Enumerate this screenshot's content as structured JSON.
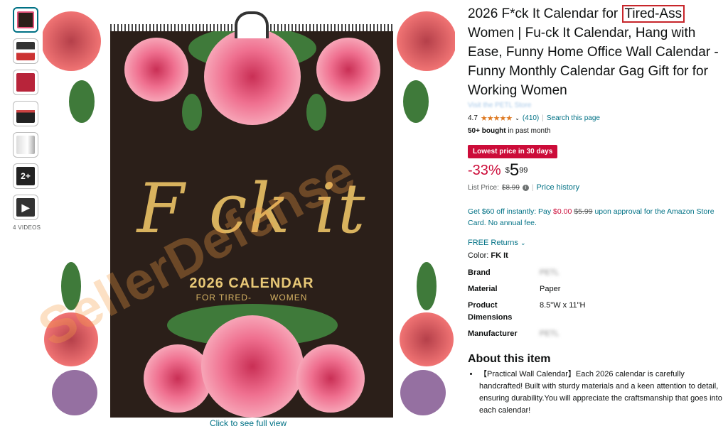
{
  "thumbnails": {
    "items": [
      {
        "name": "thumb-1",
        "selected": true,
        "label": ""
      },
      {
        "name": "thumb-2",
        "label": ""
      },
      {
        "name": "thumb-3",
        "label": ""
      },
      {
        "name": "thumb-4",
        "label": ""
      },
      {
        "name": "thumb-5",
        "label": ""
      },
      {
        "name": "thumb-6",
        "label": "2+"
      },
      {
        "name": "thumb-7",
        "label": "▶"
      }
    ],
    "videos_label": "4 VIDEOS"
  },
  "main_image": {
    "calendar_title": "F ck it",
    "calendar_year": "2026 CALENDAR",
    "calendar_subtitle": "FOR TIRED-      WOMEN",
    "click_full_view": "Click to see full view",
    "watermark": "SellerDefense"
  },
  "product": {
    "title_pre": "2026 F*ck It Calendar for ",
    "title_highlight": "Tired-Ass",
    "title_post": " Women | Fu-ck It Calendar, Hang with Ease, Funny Home Office Wall Calendar - Funny Monthly Calendar Gag Gift for for Working Women",
    "store": "Visit the PETL Store",
    "rating": "4.7",
    "stars": "★★★★★",
    "rating_count": "(410)",
    "search_page": "Search this page",
    "bought": "50+ bought",
    "bought_suffix": " in past month",
    "deal_badge": "Lowest price in 30 days",
    "discount": "-33%",
    "price_symbol": "$",
    "price_whole": "5",
    "price_fraction": "99",
    "list_price_label": "List Price: ",
    "list_price": "$8.99",
    "price_history": "Price history",
    "card_offer_1": "Get $60 off instantly: Pay ",
    "card_offer_price": "$0.00",
    "card_offer_old": "$5.99",
    "card_offer_2": " upon approval for the Amazon Store Card. No annual fee.",
    "free_returns": "FREE Returns",
    "color_label": "Color: ",
    "color_value": "FK It",
    "specs": [
      {
        "key": "Brand",
        "value": "PETL",
        "blurred": true
      },
      {
        "key": "Material",
        "value": "Paper"
      },
      {
        "key": "Product Dimensions",
        "value": "8.5\"W x 11\"H"
      },
      {
        "key": "Manufacturer",
        "value": "PETL",
        "blurred": true
      }
    ],
    "about_title": "About this item",
    "bullet_1": "【Practical Wall Calendar】Each 2026 calendar is carefully handcrafted! Built with sturdy materials and a keen attention to detail, ensuring durability.You will appreciate the craftsmanship that goes into each calendar!"
  },
  "colors": {
    "link": "#007185",
    "deal": "#cc0c39",
    "star": "#de7921",
    "highlight_border": "#c7252a"
  }
}
